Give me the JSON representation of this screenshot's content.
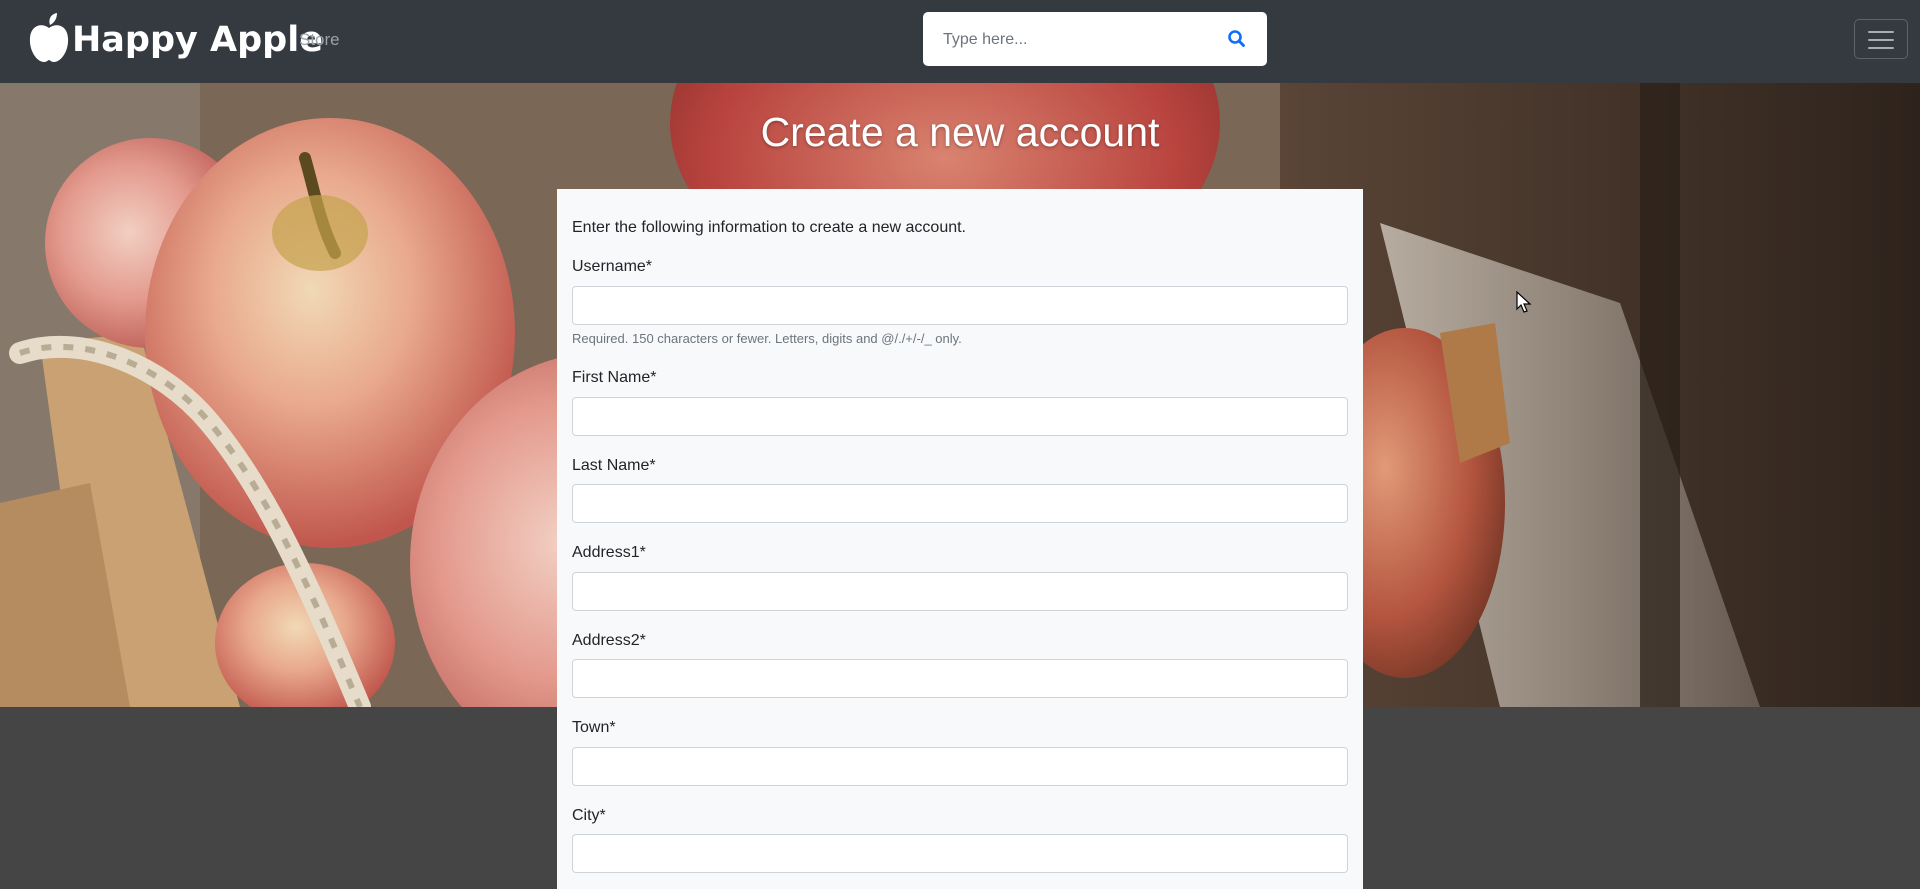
{
  "navbar": {
    "brand": "Happy Apple",
    "store_link": "Store",
    "search": {
      "placeholder": "Type here...",
      "value": ""
    },
    "icons": {
      "logo": "apple-icon",
      "search": "search-icon",
      "menu": "hamburger-menu-icon"
    }
  },
  "hero": {
    "title": "Create a new account"
  },
  "form": {
    "intro": "Enter the following information to create a new account.",
    "username": {
      "label": "Username*",
      "value": "",
      "help": "Required. 150 characters or fewer. Letters, digits and @/./+/-/_ only."
    },
    "first_name": {
      "label": "First Name*",
      "value": ""
    },
    "last_name": {
      "label": "Last Name*",
      "value": ""
    },
    "address1": {
      "label": "Address1*",
      "value": ""
    },
    "address2": {
      "label": "Address2*",
      "value": ""
    },
    "town": {
      "label": "Town*",
      "value": ""
    },
    "city": {
      "label": "City*",
      "value": ""
    }
  },
  "colors": {
    "navbar_bg": "#343a40",
    "page_bg": "#454545",
    "card_bg": "#f8f9fa",
    "search_icon": "#0d6efd"
  }
}
